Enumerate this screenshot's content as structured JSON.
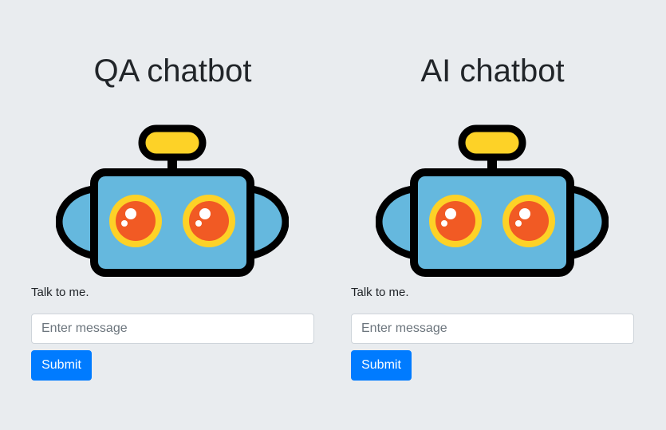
{
  "colors": {
    "background": "#e9ecef",
    "primary_button": "#007bff",
    "robot_body": "#65b8de",
    "robot_outline": "#000000",
    "robot_antenna": "#fdd227",
    "robot_eye_ring": "#fdd227",
    "robot_eye": "#f15a24"
  },
  "panels": [
    {
      "title": "QA chatbot",
      "robot_icon": "robot-icon",
      "prompt": "Talk to me.",
      "input": {
        "placeholder": "Enter message",
        "value": ""
      },
      "submit_label": "Submit"
    },
    {
      "title": "AI chatbot",
      "robot_icon": "robot-icon",
      "prompt": "Talk to me.",
      "input": {
        "placeholder": "Enter message",
        "value": ""
      },
      "submit_label": "Submit"
    }
  ]
}
